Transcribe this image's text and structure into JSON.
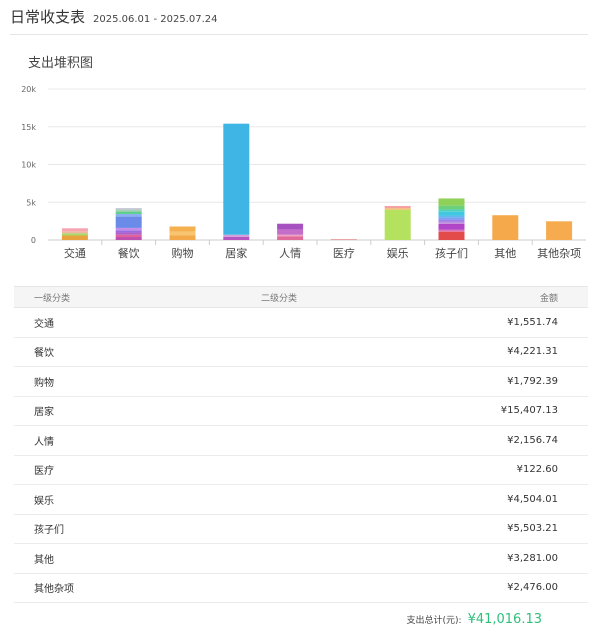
{
  "header": {
    "title": "日常收支表",
    "date_range": "2025.06.01 - 2025.07.24"
  },
  "chart_data": {
    "type": "bar",
    "stacked": true,
    "title": "支出堆积图",
    "ylim": [
      0,
      20000
    ],
    "yticks": [
      0,
      5000,
      10000,
      15000,
      20000
    ],
    "ytick_labels": [
      "0",
      "5k",
      "10k",
      "15k",
      "20k"
    ],
    "grid": true,
    "categories": [
      "交通",
      "餐饮",
      "购物",
      "居家",
      "人情",
      "医疗",
      "娱乐",
      "孩子们",
      "其他",
      "其他杂项"
    ],
    "stacks": [
      [
        {
          "v": 600,
          "c": "#e8a23e"
        },
        {
          "v": 300,
          "c": "#a6d86a"
        },
        {
          "v": 250,
          "c": "#f0b5a0"
        },
        {
          "v": 402,
          "c": "#f5a4b0"
        }
      ],
      [
        {
          "v": 400,
          "c": "#c050b0"
        },
        {
          "v": 300,
          "c": "#e0609a"
        },
        {
          "v": 300,
          "c": "#b060c8"
        },
        {
          "v": 250,
          "c": "#9a6ce0"
        },
        {
          "v": 350,
          "c": "#c68ee8"
        },
        {
          "v": 1500,
          "c": "#6b8be8"
        },
        {
          "v": 350,
          "c": "#8db0f0"
        },
        {
          "v": 271,
          "c": "#5ccf8c"
        },
        {
          "v": 200,
          "c": "#8ad0a0"
        },
        {
          "v": 300,
          "c": "#c0c8d0"
        }
      ],
      [
        {
          "v": 600,
          "c": "#f3a94a"
        },
        {
          "v": 500,
          "c": "#f7c470"
        },
        {
          "v": 692,
          "c": "#f5b050"
        }
      ],
      [
        {
          "v": 400,
          "c": "#b656c0"
        },
        {
          "v": 300,
          "c": "#d6a0dc"
        },
        {
          "v": 14707,
          "c": "#3fb5e5"
        }
      ],
      [
        {
          "v": 500,
          "c": "#e06a9a"
        },
        {
          "v": 200,
          "c": "#f0a0c0"
        },
        {
          "v": 700,
          "c": "#c56ec9"
        },
        {
          "v": 757,
          "c": "#a552c0"
        }
      ],
      [
        {
          "v": 123,
          "c": "#e8a0a0"
        }
      ],
      [
        {
          "v": 4000,
          "c": "#b5e25e"
        },
        {
          "v": 200,
          "c": "#f0c070"
        },
        {
          "v": 304,
          "c": "#f4a1a1"
        }
      ],
      [
        {
          "v": 1100,
          "c": "#e34a4a"
        },
        {
          "v": 250,
          "c": "#e070b0"
        },
        {
          "v": 800,
          "c": "#b045c8"
        },
        {
          "v": 300,
          "c": "#c090e0"
        },
        {
          "v": 250,
          "c": "#9a80e8"
        },
        {
          "v": 300,
          "c": "#7aa0f0"
        },
        {
          "v": 250,
          "c": "#60b8f0"
        },
        {
          "v": 500,
          "c": "#40c8e0"
        },
        {
          "v": 300,
          "c": "#50d0c0"
        },
        {
          "v": 500,
          "c": "#6ad07a"
        },
        {
          "v": 953,
          "c": "#8fd058"
        }
      ],
      [
        {
          "v": 3281,
          "c": "#f5a94a"
        }
      ],
      [
        {
          "v": 2476,
          "c": "#f5ab4e"
        }
      ]
    ]
  },
  "table": {
    "headers": [
      "一级分类",
      "二级分类",
      "金额"
    ],
    "rows": [
      [
        "交通",
        "",
        "¥1,551.74"
      ],
      [
        "餐饮",
        "",
        "¥4,221.31"
      ],
      [
        "购物",
        "",
        "¥1,792.39"
      ],
      [
        "居家",
        "",
        "¥15,407.13"
      ],
      [
        "人情",
        "",
        "¥2,156.74"
      ],
      [
        "医疗",
        "",
        "¥122.60"
      ],
      [
        "娱乐",
        "",
        "¥4,504.01"
      ],
      [
        "孩子们",
        "",
        "¥5,503.21"
      ],
      [
        "其他",
        "",
        "¥3,281.00"
      ],
      [
        "其他杂项",
        "",
        "¥2,476.00"
      ]
    ]
  },
  "total": {
    "label": "支出总计(元):",
    "value": "¥41,016.13",
    "color": "#2ec07a"
  }
}
